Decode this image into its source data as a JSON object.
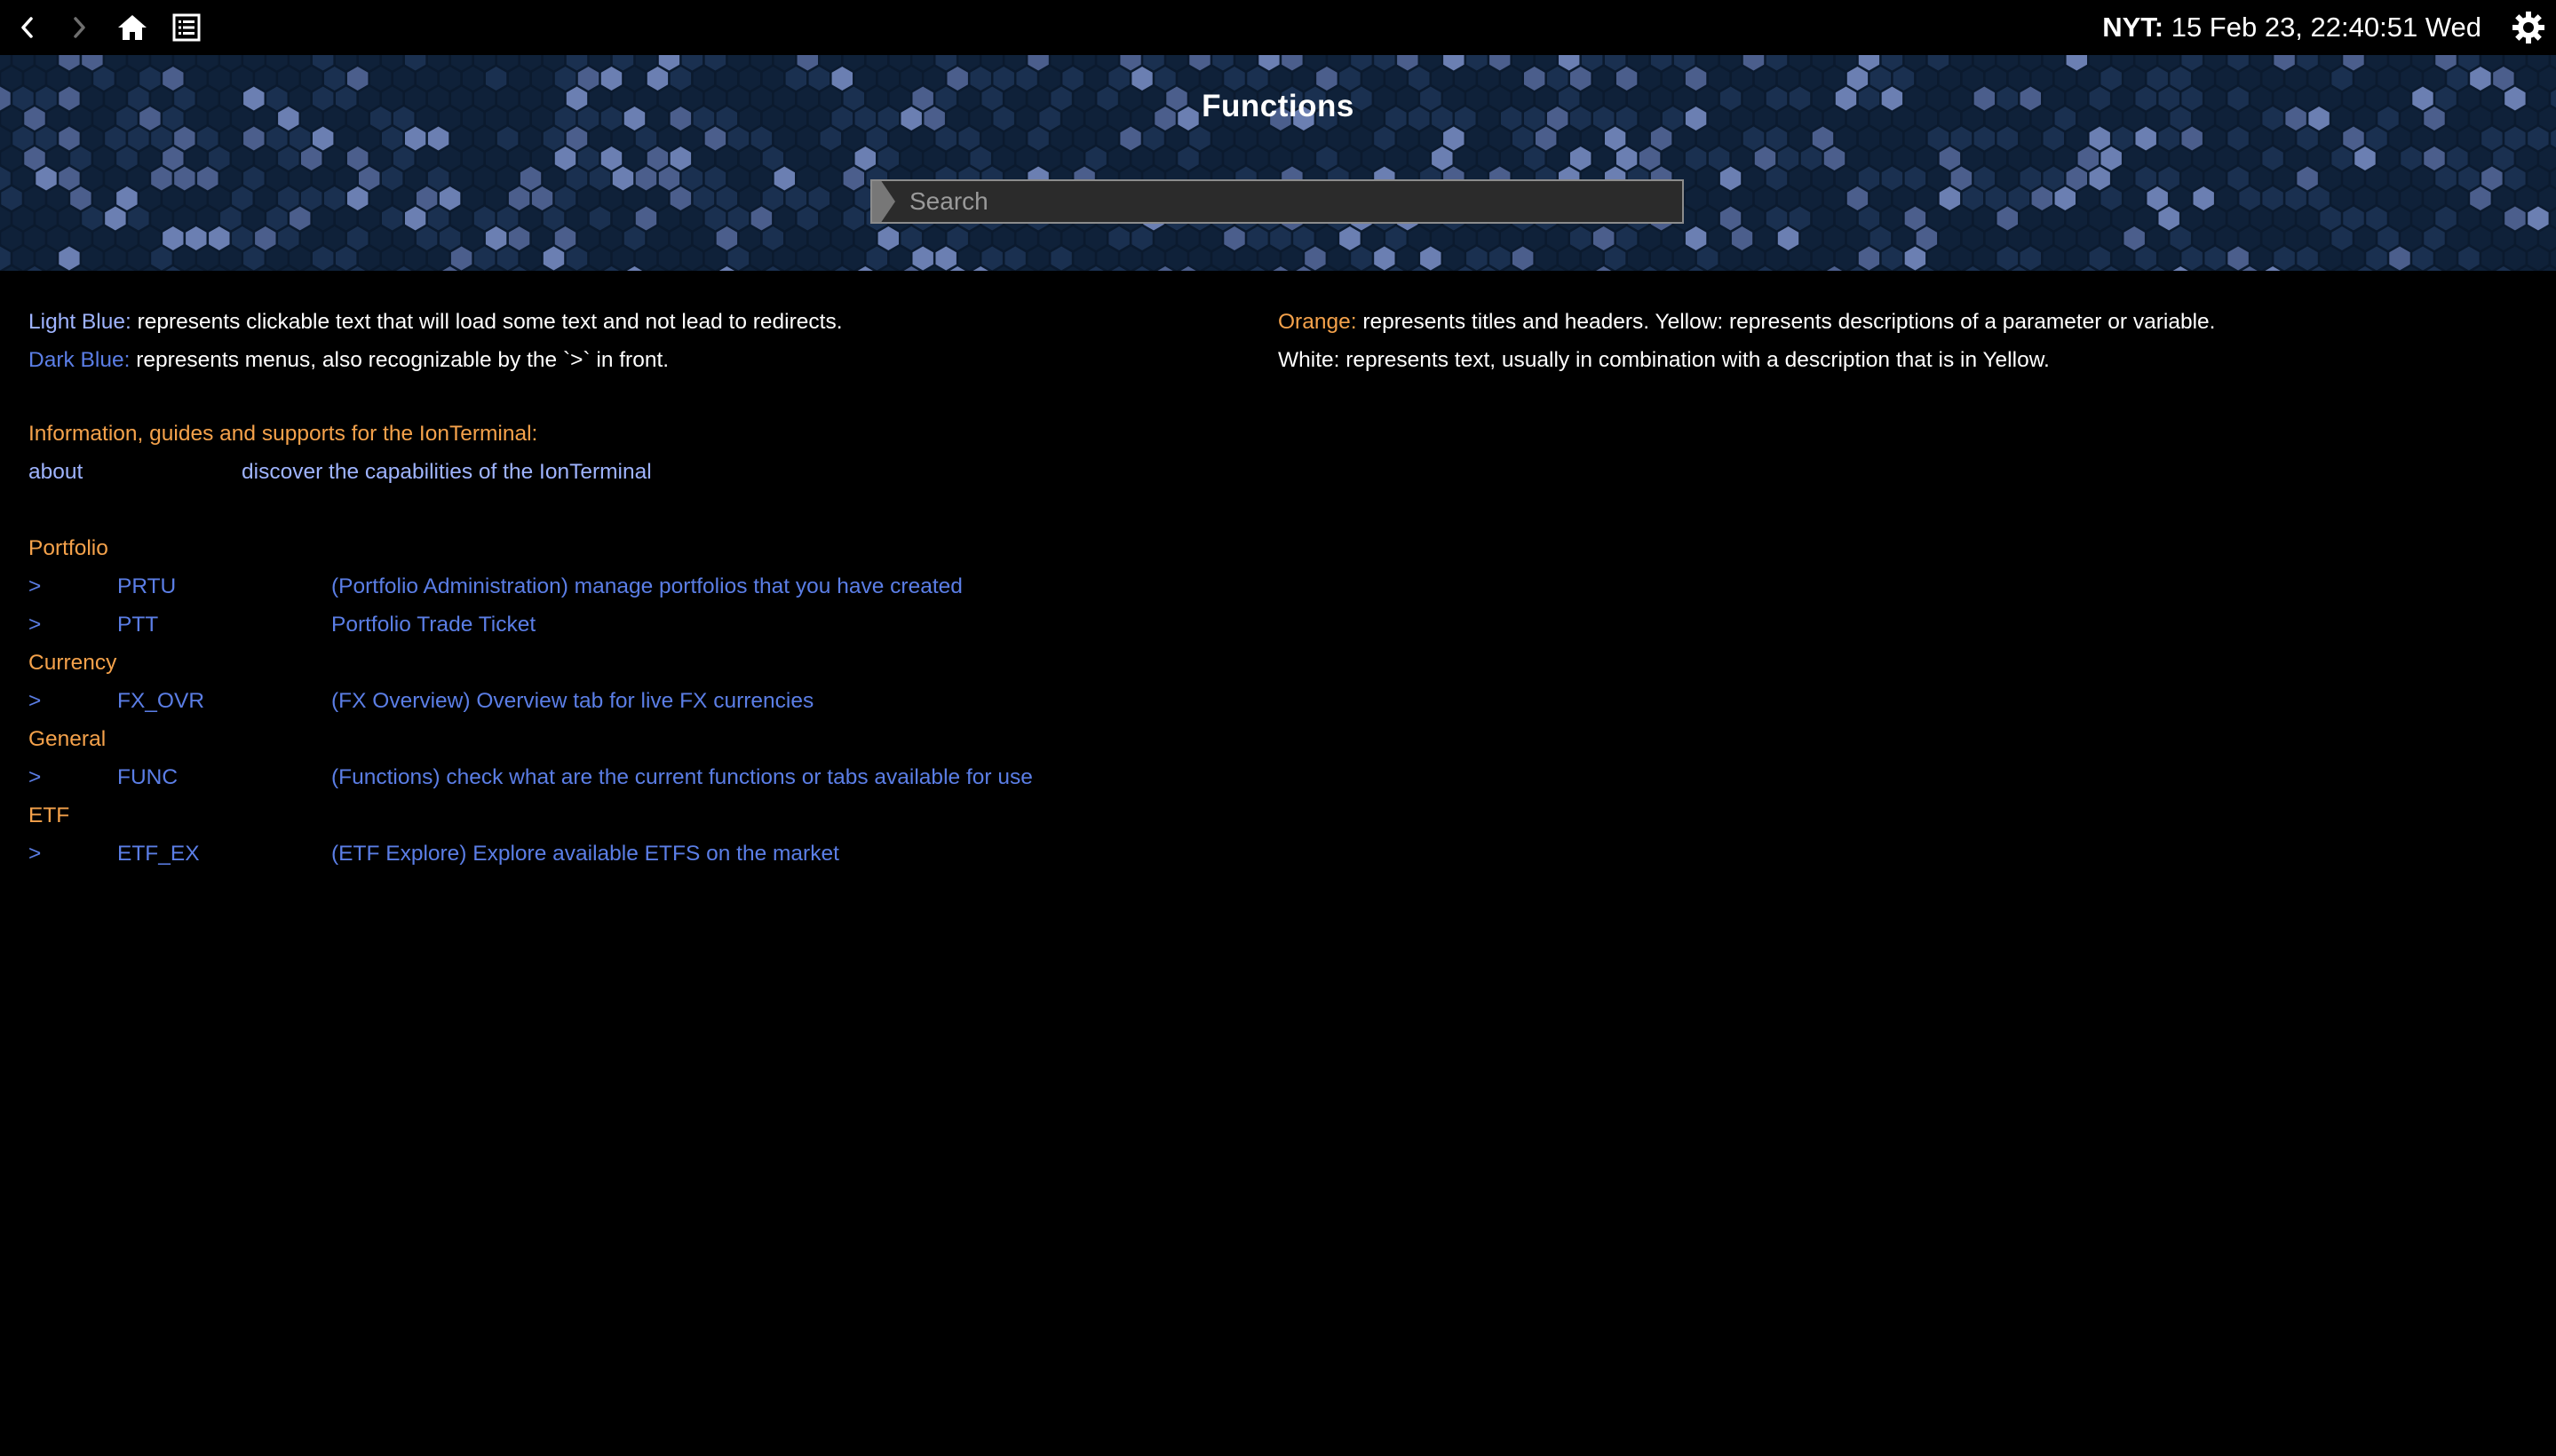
{
  "topbar": {
    "back_icon": "chevron-left-icon",
    "forward_icon": "chevron-right-icon",
    "home_icon": "home-icon",
    "list_icon": "list-icon",
    "clock_label": "NYT:",
    "clock_value": "15 Feb 23, 22:40:51 Wed",
    "settings_icon": "gear-icon"
  },
  "banner": {
    "title": "Functions",
    "search_placeholder": "Search"
  },
  "legend": {
    "left": [
      {
        "term": "Light Blue:",
        "text": "represents clickable text that will load some text and not lead to redirects."
      },
      {
        "term": "Dark Blue:",
        "text": "represents menus, also recognizable by the `>` in front."
      }
    ],
    "right": [
      {
        "term": "Orange:",
        "text": "represents titles and headers. Yellow: represents descriptions of a parameter or variable."
      },
      {
        "term": "",
        "text": "White: represents text, usually in combination with a description that is in Yellow."
      }
    ]
  },
  "info": {
    "heading": "Information, guides and supports for the IonTerminal:",
    "about_label": "about",
    "about_desc": "discover the capabilities of the IonTerminal"
  },
  "sections": [
    {
      "title": "Portfolio",
      "items": [
        {
          "marker": ">",
          "code": "PRTU",
          "desc": "(Portfolio Administration) manage portfolios that you have created"
        },
        {
          "marker": ">",
          "code": "PTT",
          "desc": "Portfolio Trade Ticket"
        }
      ]
    },
    {
      "title": "Currency",
      "items": [
        {
          "marker": ">",
          "code": "FX_OVR",
          "desc": "(FX Overview) Overview tab for live FX currencies"
        }
      ]
    },
    {
      "title": "General",
      "items": [
        {
          "marker": ">",
          "code": "FUNC",
          "desc": "(Functions) check what are the current functions or tabs available for use"
        }
      ]
    },
    {
      "title": "ETF",
      "items": [
        {
          "marker": ">",
          "code": "ETF_EX",
          "desc": "(ETF Explore) Explore available ETFS on the market"
        }
      ]
    }
  ],
  "colors": {
    "light_blue": "#9fb4ff",
    "dark_blue": "#5b7ee6",
    "orange": "#f5a24b",
    "banner_bg": "#0b1a2e"
  }
}
